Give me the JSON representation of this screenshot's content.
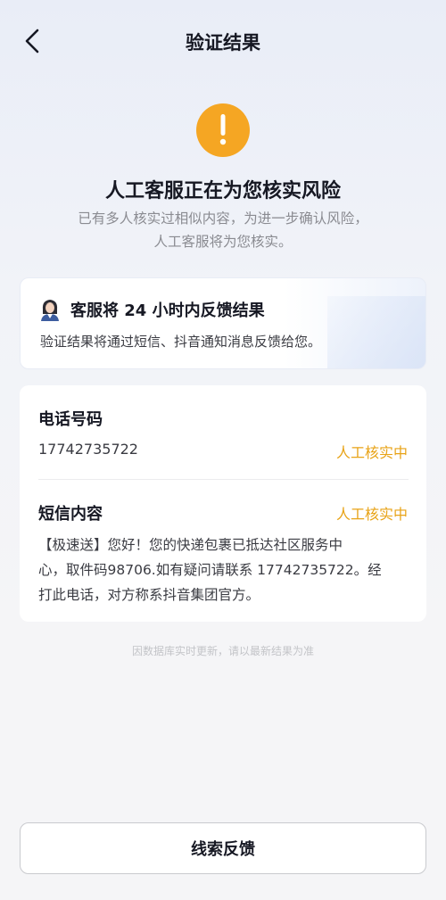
{
  "nav": {
    "title": "验证结果",
    "back_icon": "chevron-left-icon"
  },
  "result": {
    "icon": "exclamation-icon",
    "icon_color": "#f5a623",
    "headline": "人工客服正在为您核实风险",
    "subtext_line1": "已有多人核实过相似内容，为进一步确认风险，",
    "subtext_line2": "人工客服将为您核实。"
  },
  "notice": {
    "title": "客服将 24 小时内反馈结果",
    "description": "验证结果将通过短信、抖音通知消息反馈给您。"
  },
  "info": {
    "phone_label": "电话号码",
    "phone_value": "17742735722",
    "phone_status": "人工核实中",
    "sms_label": "短信内容",
    "sms_status": "人工核实中",
    "sms_content_line1": "【极速送】您好！您的快递包裹已抵达社区服务中",
    "sms_content_line2": "心，取件码98706.如有疑问请联系 17742735722。经",
    "sms_content_line3": "打此电话，对方称系抖音集团官方。",
    "status_color": "#e8a317"
  },
  "footnote": "因数据库实时更新，请以最新结果为准",
  "feedback_button": "线索反馈"
}
